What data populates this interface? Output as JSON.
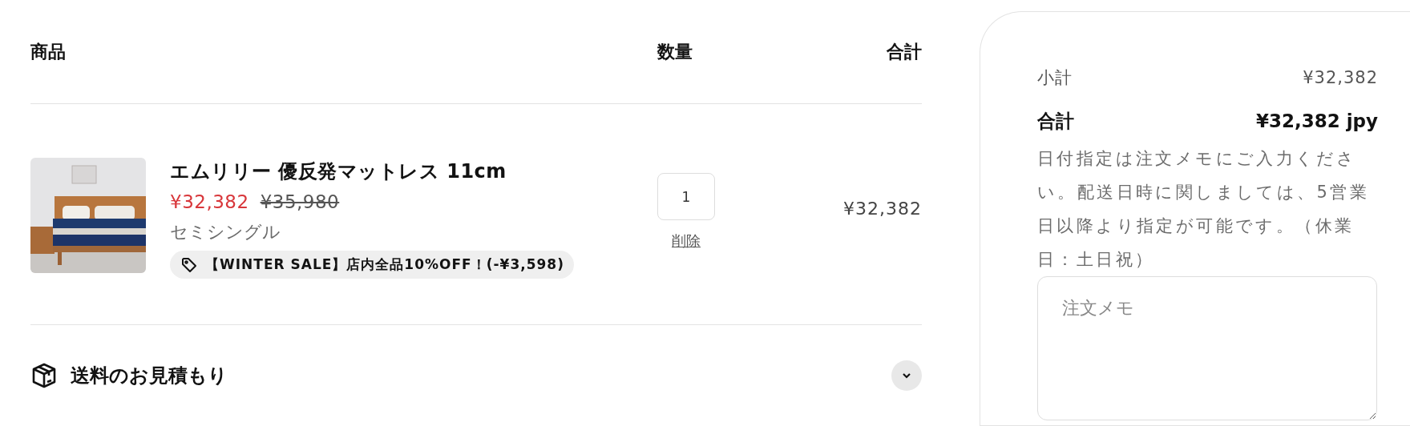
{
  "columns": [
    "商品",
    "数量",
    "合計"
  ],
  "items": [
    {
      "title": "エムリリー 優反発マットレス 11cm",
      "sale_price": "¥32,382",
      "compare_price": "¥35,980",
      "variant": "セミシングル",
      "discount": "【WINTER SALE】店内全品10%OFF！(-¥3,598)",
      "quantity": "1",
      "remove": "削除",
      "line_total": "¥32,382"
    }
  ],
  "shipping": {
    "label": "送料のお見積もり",
    "expanded": false
  },
  "summary": {
    "subtotal_label": "小計",
    "subtotal": "¥32,382",
    "total_label": "合計",
    "total": "¥32,382 jpy",
    "note": "日付指定は注文メモにご入力ください。配送日時に関しましては、5営業日以降より指定が可能です。（休業日：土日祝）",
    "memo_placeholder": "注文メモ"
  }
}
